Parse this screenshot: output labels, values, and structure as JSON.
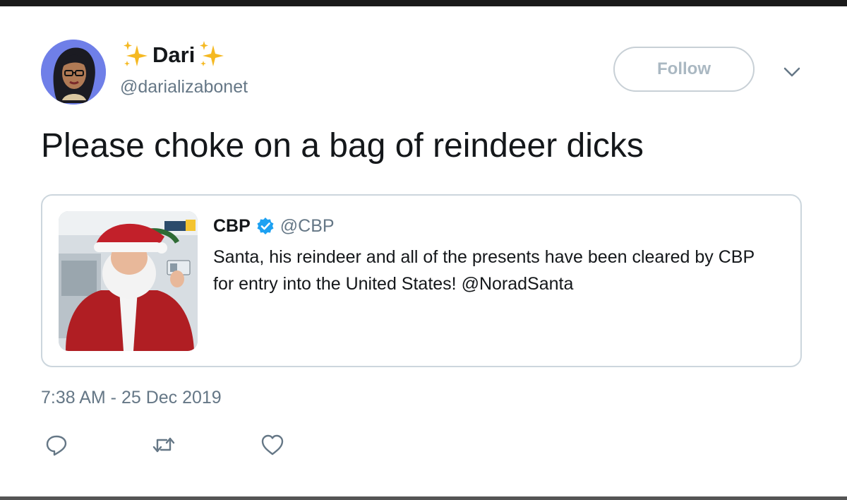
{
  "tweet": {
    "author": {
      "display_name": "Dari",
      "name_emoji": "sparkles",
      "handle": "@darializabonet",
      "avatar": "avatar-illustration"
    },
    "follow_label": "Follow",
    "menu_icon": "chevron-down-icon",
    "text": "Please choke on a bag of reindeer dicks",
    "timestamp": "7:38 AM - 25 Dec 2019",
    "actions": [
      "reply-icon",
      "retweet-icon",
      "like-icon"
    ]
  },
  "quoted_tweet": {
    "name": "CBP",
    "verified": true,
    "handle": "@CBP",
    "image": "santa-photo",
    "text": "Santa, his reindeer and all of the presents have been cleared by CBP for entry into the United States! @NoradSanta"
  },
  "colors": {
    "text_primary": "#14171a",
    "text_secondary": "#657786",
    "border": "#ccd6dd",
    "verified_blue": "#1da1f2",
    "follow_text": "#aab8c2"
  }
}
